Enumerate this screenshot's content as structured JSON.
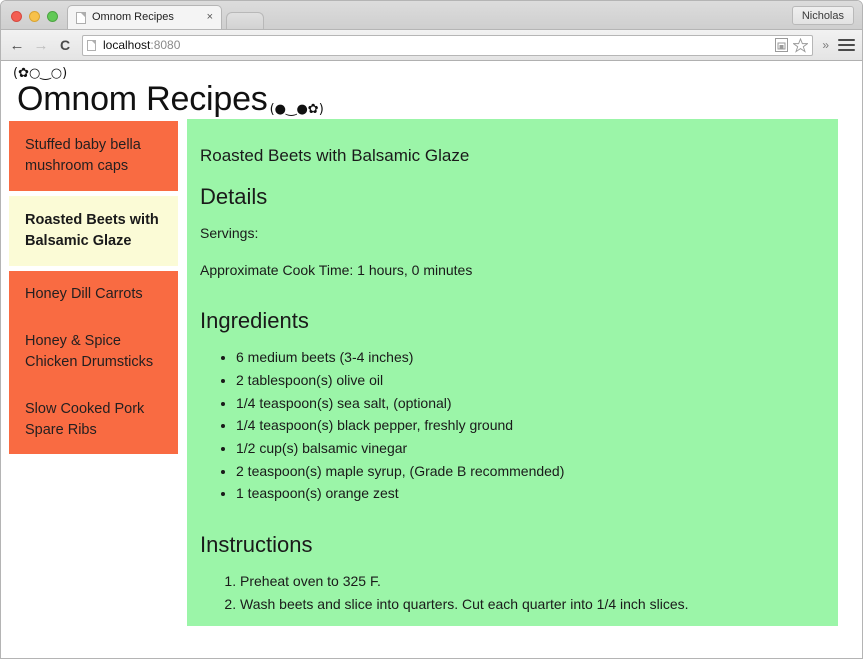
{
  "browser": {
    "traffic_lights": [
      "close",
      "minimize",
      "zoom"
    ],
    "tab": {
      "title": "Omnom Recipes",
      "close_label": "×"
    },
    "new_tab_label": "",
    "profile_name": "Nicholas",
    "nav": {
      "back": "←",
      "forward": "→",
      "reload": "C"
    },
    "omnibox": {
      "host": "localhost",
      "port": ":8080",
      "full_url": "localhost:8080"
    },
    "omni_icons": [
      "save-page-icon",
      "bookmark-star-icon"
    ],
    "overflow_label": "»",
    "menu_label": "menu"
  },
  "site": {
    "kaomoji_top": "(✿○‿○)",
    "title": "Omnom Recipes",
    "kaomoji_bottom": "(●‿●✿)"
  },
  "sidebar": {
    "items": [
      {
        "label": "Stuffed baby bella mushroom caps",
        "selected": false
      },
      {
        "label": "Roasted Beets with Balsamic Glaze",
        "selected": true
      },
      {
        "label": "Honey Dill Carrots",
        "selected": false
      },
      {
        "label": "Honey & Spice Chicken Drumsticks",
        "selected": false
      },
      {
        "label": "Slow Cooked Pork Spare Ribs",
        "selected": false
      }
    ]
  },
  "recipe": {
    "name": "Roasted Beets with Balsamic Glaze",
    "details_heading": "Details",
    "servings_line": "Servings:",
    "cook_time_line": "Approximate Cook Time: 1 hours, 0 minutes",
    "ingredients_heading": "Ingredients",
    "ingredients": [
      "6 medium beets (3-4 inches)",
      "2 tablespoon(s) olive oil",
      "1/4 teaspoon(s) sea salt, (optional)",
      "1/4 teaspoon(s) black pepper, freshly ground",
      "1/2 cup(s) balsamic vinegar",
      "2 teaspoon(s) maple syrup, (Grade B recommended)",
      "1 teaspoon(s) orange zest"
    ],
    "instructions_heading": "Instructions",
    "instructions": [
      "Preheat oven to 325 F.",
      "Wash beets and slice into quarters. Cut each quarter into 1/4 inch slices."
    ]
  },
  "colors": {
    "content_green": "#9bf5a8",
    "item_orange": "#f96b42",
    "item_selected_cream": "#fbfbd6",
    "text": "#1a1a1a"
  }
}
